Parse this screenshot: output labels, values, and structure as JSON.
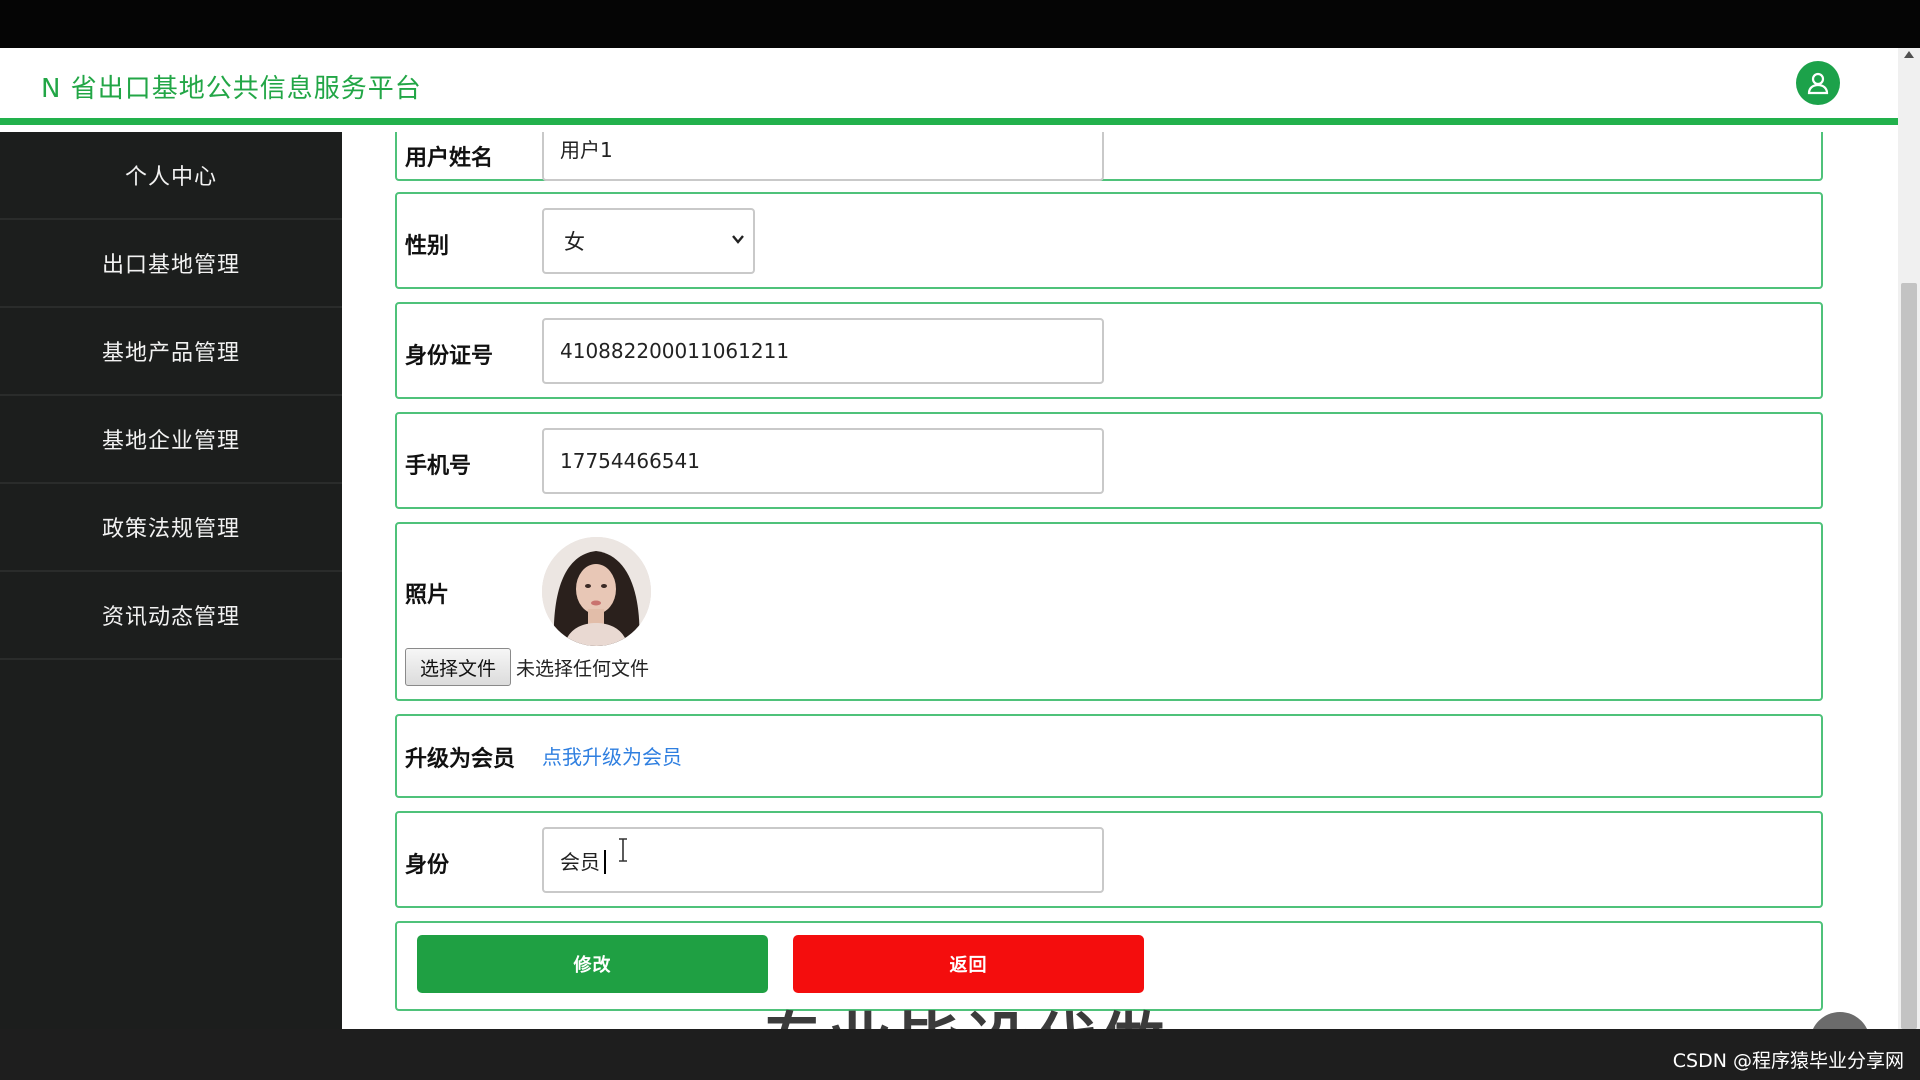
{
  "header": {
    "title": "N 省出口基地公共信息服务平台",
    "user_icon": "user-icon",
    "accent": "#22b14c"
  },
  "sidebar": {
    "items": [
      {
        "label": "个人中心"
      },
      {
        "label": "出口基地管理"
      },
      {
        "label": "基地产品管理"
      },
      {
        "label": "基地企业管理"
      },
      {
        "label": "政策法规管理"
      },
      {
        "label": "资讯动态管理"
      }
    ]
  },
  "form": {
    "name": {
      "label": "用户姓名",
      "value": "用户1"
    },
    "gender": {
      "label": "性别",
      "value": "女"
    },
    "id_number": {
      "label": "身份证号",
      "value": "410882200011061211"
    },
    "phone": {
      "label": "手机号",
      "value": "17754466541"
    },
    "photo": {
      "label": "照片",
      "file_button": "选择文件",
      "file_status": "未选择任何文件"
    },
    "upgrade": {
      "label": "升级为会员",
      "link": "点我升级为会员"
    },
    "identity": {
      "label": "身份",
      "value": "会员"
    },
    "buttons": {
      "edit": "修改",
      "back": "返回"
    }
  },
  "overlay": {
    "text": "专业毕设代做"
  },
  "watermark": {
    "text": "CSDN @程序猿毕业分享网"
  },
  "colors": {
    "edit_button": "#1fa043",
    "back_button": "#f40d0d",
    "link": "#2f7fe0",
    "sidebar_bg": "#1c1e1d"
  }
}
